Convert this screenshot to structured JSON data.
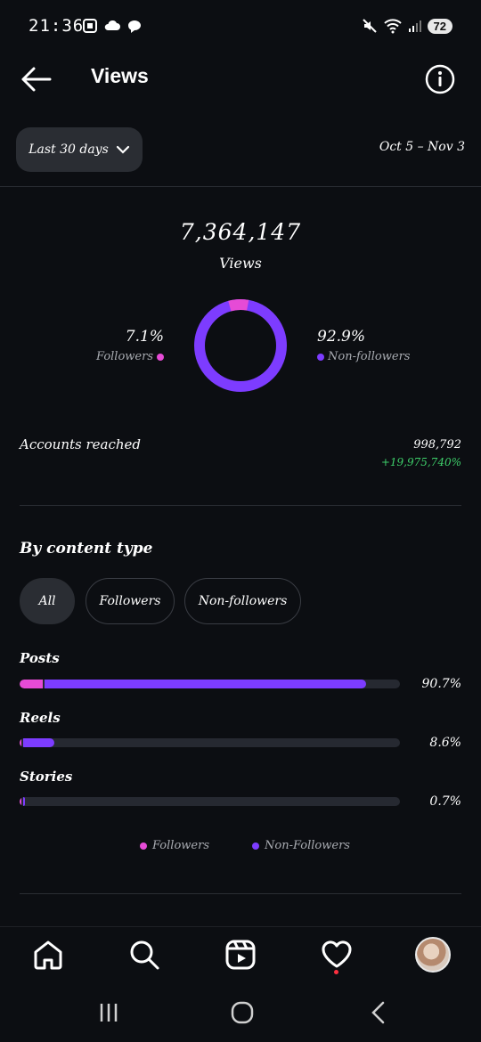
{
  "status_bar": {
    "time": "21:36",
    "battery": "72"
  },
  "header": {
    "title": "Views"
  },
  "filters": {
    "range_label": "Last 30 days",
    "date_range": "Oct 5 – Nov 3"
  },
  "summary": {
    "total_views": "7,364,147",
    "total_label": "Views",
    "followers_pct": "7.1%",
    "followers_label": "Followers",
    "followers_fraction": 0.071,
    "nonfollowers_pct": "92.9%",
    "nonfollowers_label": "Non-followers",
    "nonfollowers_fraction": 0.929
  },
  "accounts_reached": {
    "label": "Accounts reached",
    "value": "998,792",
    "change": "+19,975,740%"
  },
  "content_type": {
    "title": "By content type",
    "chips": [
      "All",
      "Followers",
      "Non-followers"
    ],
    "selected": "All",
    "rows": [
      {
        "label": "Posts",
        "pct": "90.7%",
        "followers_fraction": 0.06,
        "nonfollowers_fraction": 0.847
      },
      {
        "label": "Reels",
        "pct": "8.6%",
        "followers_fraction": 0.004,
        "nonfollowers_fraction": 0.082
      },
      {
        "label": "Stories",
        "pct": "0.7%",
        "followers_fraction": 0.002,
        "nonfollowers_fraction": 0.005
      }
    ],
    "legend": [
      "Followers",
      "Non-Followers"
    ]
  },
  "colors": {
    "followers": "#e64bd6",
    "nonfollowers": "#7d3cff",
    "positive": "#3ecf6a"
  },
  "nav_icons": [
    "home-icon",
    "search-icon",
    "reels-icon",
    "heart-icon",
    "avatar"
  ]
}
